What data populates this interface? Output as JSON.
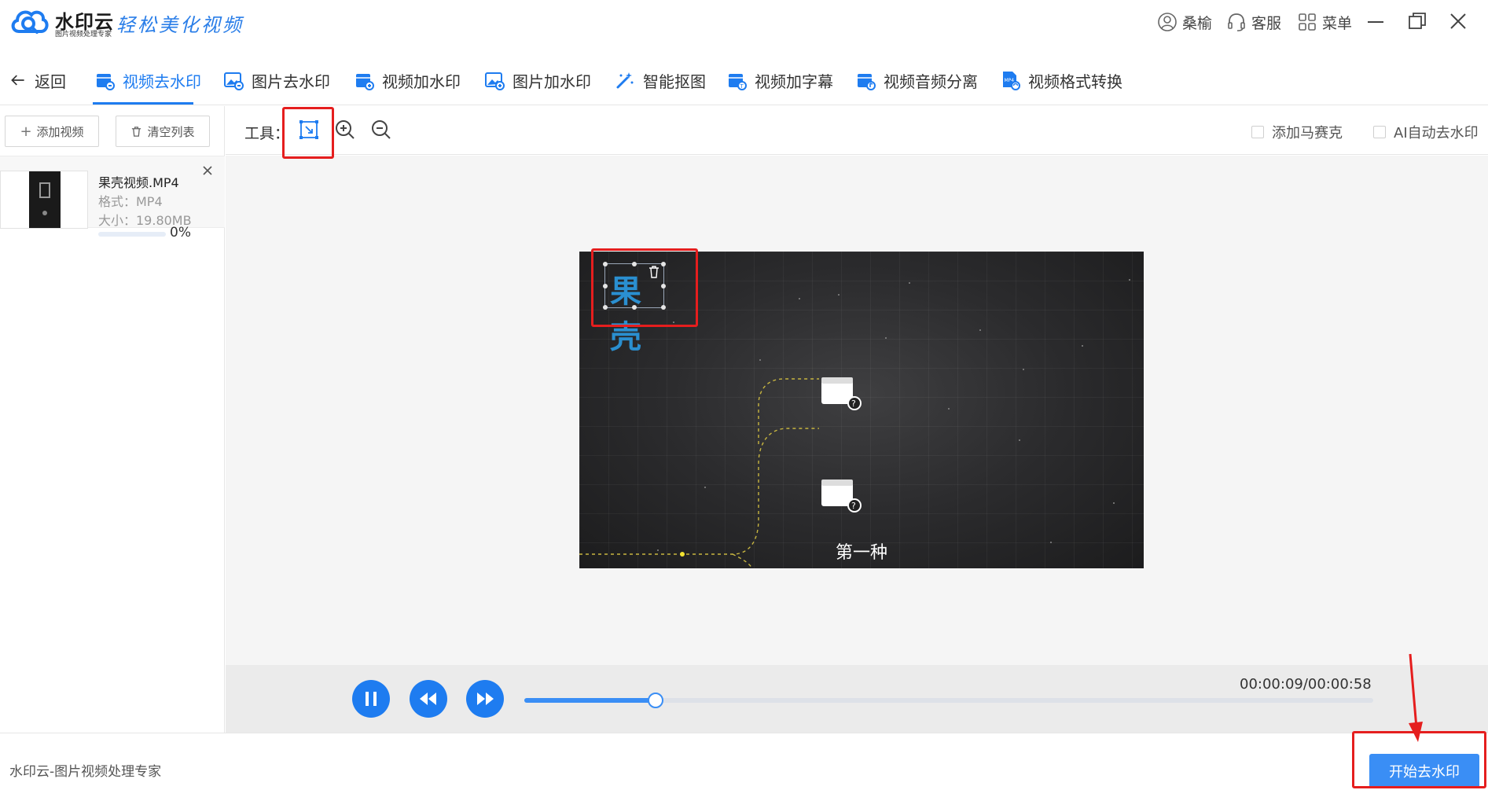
{
  "app": {
    "brand_name": "水印云",
    "brand_sub": "图片视频处理专家",
    "slogan": "轻松美化视频",
    "user_name": "桑榆",
    "service_label": "客服",
    "menu_label": "菜单"
  },
  "nav": {
    "back_label": "返回",
    "tabs": [
      {
        "label": "视频去水印",
        "icon": "video-watermark-remove-icon",
        "active": true
      },
      {
        "label": "图片去水印",
        "icon": "image-watermark-remove-icon",
        "active": false
      },
      {
        "label": "视频加水印",
        "icon": "video-watermark-add-icon",
        "active": false
      },
      {
        "label": "图片加水印",
        "icon": "image-watermark-add-icon",
        "active": false
      },
      {
        "label": "智能抠图",
        "icon": "magic-wand-icon",
        "active": false
      },
      {
        "label": "视频加字幕",
        "icon": "video-subtitle-icon",
        "active": false
      },
      {
        "label": "视频音频分离",
        "icon": "video-audio-split-icon",
        "active": false
      },
      {
        "label": "视频格式转换",
        "icon": "mp4-convert-icon",
        "active": false
      }
    ]
  },
  "sidebar": {
    "add_video_label": "添加视频",
    "clear_list_label": "清空列表",
    "files": [
      {
        "name": "果壳视频.MP4",
        "format": "格式：MP4",
        "size": "大小：19.80MB",
        "progress": 0,
        "progress_label": "0%"
      }
    ]
  },
  "toolbar": {
    "tools_label": "工具：",
    "mosaic_label": "添加马赛克",
    "ai_label": "AI自动去水印"
  },
  "video": {
    "watermark_text": "果壳",
    "caption": "第一种"
  },
  "player": {
    "time": "00:00:09/00:00:58",
    "progress": 0.155
  },
  "footer": {
    "text": "水印云-图片视频处理专家",
    "start_label": "开始去水印"
  },
  "colors": {
    "accent": "#1e7cf0",
    "annotation_red": "#e51e1e",
    "video_bg": "#2b2b2d"
  }
}
